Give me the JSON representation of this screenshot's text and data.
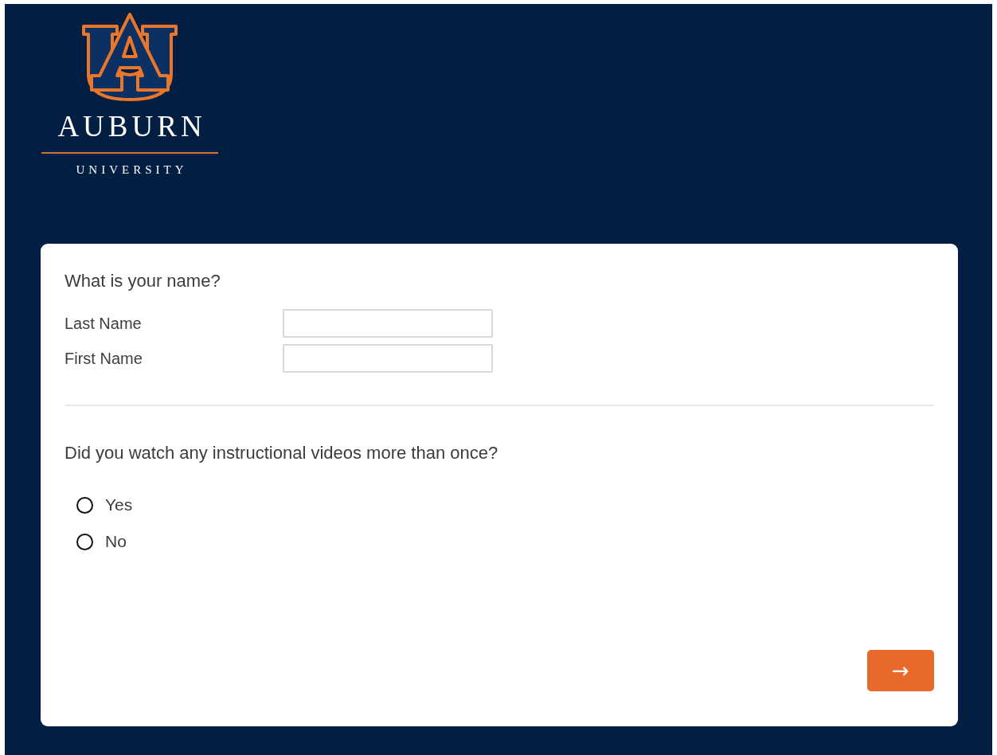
{
  "logo": {
    "wordmark": "AUBURN",
    "subtitle": "UNIVERSITY"
  },
  "form": {
    "name_question": "What is your name?",
    "fields": [
      {
        "label": "Last Name"
      },
      {
        "label": "First Name"
      }
    ],
    "choice_question": "Did you watch any instructional videos more than once?",
    "options": [
      {
        "label": "Yes",
        "selected": false
      },
      {
        "label": "No",
        "selected": false
      }
    ],
    "next_button": "→"
  }
}
